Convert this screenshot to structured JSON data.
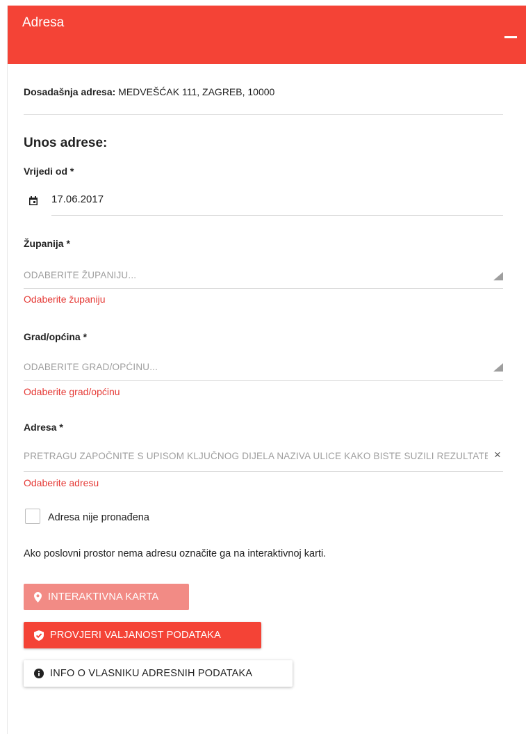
{
  "panel": {
    "title": "Adresa",
    "accent_color": "#f44336",
    "collapse_icon": "minus-icon"
  },
  "previous_address": {
    "label": "Dosadašnja adresa:",
    "value": " MEDVEŠĆAK 111, ZAGREB, 10000"
  },
  "form": {
    "section_title": "Unos adrese:",
    "valid_from": {
      "label": "Vrijedi od *",
      "icon": "calendar-icon",
      "value": "17.06.2017"
    },
    "county": {
      "label": "Županija *",
      "placeholder": "ODABERITE ŽUPANIJU...",
      "error": "Odaberite županiju"
    },
    "city": {
      "label": "Grad/općina *",
      "placeholder": "ODABERITE GRAD/OPĆINU...",
      "error": "Odaberite grad/općinu"
    },
    "address": {
      "label": "Adresa *",
      "placeholder": "PRETRAGU ZAPOČNITE S UPISOM KLJUČNOG DIJELA NAZIVA ULICE KAKO BISTE SUZILI REZULTATE",
      "clear_symbol": "×",
      "error": "Odaberite adresu"
    },
    "not_found": {
      "label": "Adresa nije pronađena",
      "checked": false
    },
    "help_text": "Ako poslovni prostor nema adresu označite ga na interaktivnoj karti."
  },
  "buttons": {
    "map": {
      "label": "INTERAKTIVNA KARTA",
      "icon": "map-marker-icon",
      "color": "#f28b85"
    },
    "validate": {
      "label": "PROVJERI VALJANOST PODATAKA",
      "icon": "shield-check-icon",
      "color": "#f44336"
    },
    "info": {
      "label": "INFO O VLASNIKU ADRESNIH PODATAKA",
      "icon": "info-icon"
    }
  }
}
